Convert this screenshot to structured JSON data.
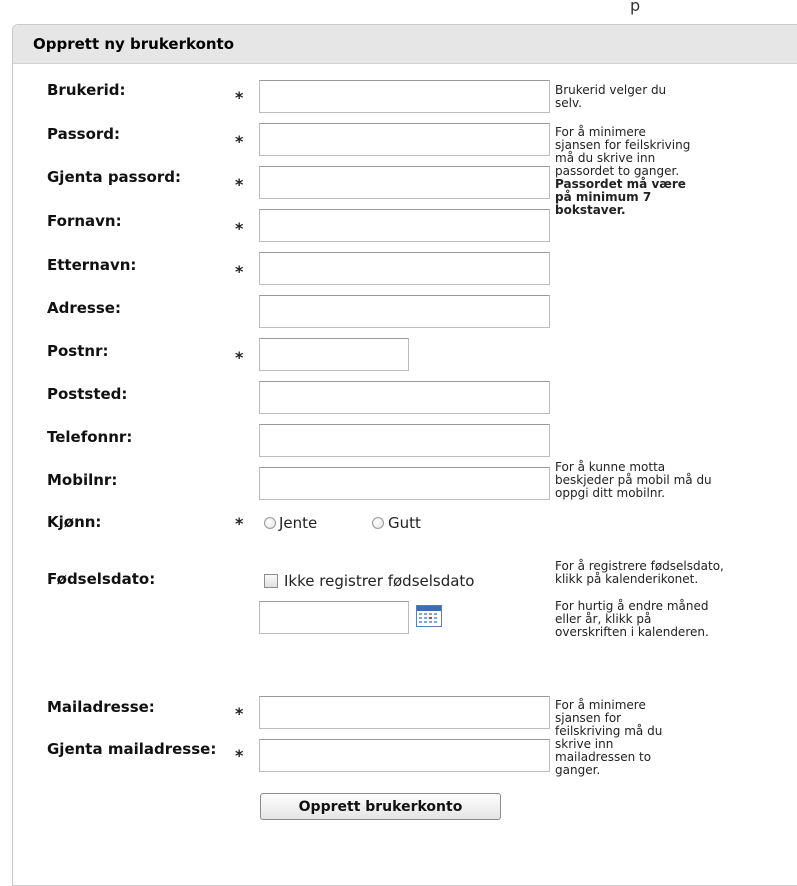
{
  "top_fragment": "p",
  "form": {
    "title": "Opprett ny brukerkonto",
    "required_marker": "*",
    "fields": {
      "brukerid": {
        "label": "Brukerid:"
      },
      "passord": {
        "label": "Passord:"
      },
      "gjenta_passord": {
        "label": "Gjenta passord:"
      },
      "fornavn": {
        "label": "Fornavn:"
      },
      "etternavn": {
        "label": "Etternavn:"
      },
      "adresse": {
        "label": "Adresse:"
      },
      "postnr": {
        "label": "Postnr:"
      },
      "poststed": {
        "label": "Poststed:"
      },
      "telefonnr": {
        "label": "Telefonnr:"
      },
      "mobilnr": {
        "label": "Mobilnr:"
      },
      "kjonn": {
        "label": "Kjønn:",
        "options": [
          "Jente",
          "Gutt"
        ]
      },
      "fodselsdato": {
        "label": "Fødselsdato:",
        "checkbox_label": "Ikke registrer fødselsdato"
      },
      "mailadresse": {
        "label": "Mailadresse:"
      },
      "gjenta_mailadresse": {
        "label": "Gjenta mailadresse:"
      }
    },
    "hints": {
      "brukerid": [
        "Brukerid velger du",
        "selv."
      ],
      "passord": [
        "For å minimere",
        "sjansen for feilskriving",
        "må du skrive inn",
        "passordet to ganger."
      ],
      "passord_bold": [
        "Passordet må være",
        "på minimum 7",
        "bokstaver."
      ],
      "mobilnr": [
        "For å kunne motta",
        "beskjeder på mobil må du",
        "oppgi ditt mobilnr."
      ],
      "fodselsdato_1": [
        "For å registrere fødselsdato,",
        "klikk på kalenderikonet."
      ],
      "fodselsdato_2": [
        "For hurtig å endre måned",
        "eller år, klikk på",
        "overskriften i kalenderen."
      ],
      "mail": [
        "For å minimere",
        "sjansen for",
        "feilskriving må du",
        "skrive inn",
        "mailadressen to",
        "ganger."
      ]
    },
    "submit_label": "Opprett brukerkonto"
  }
}
